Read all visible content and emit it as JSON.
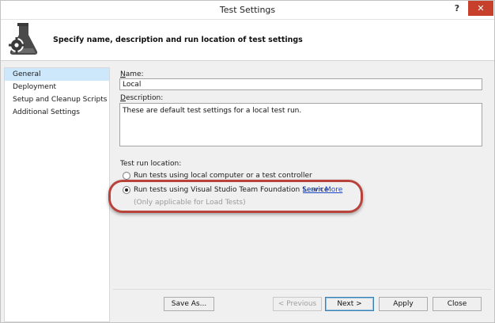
{
  "window": {
    "title": "Test Settings"
  },
  "titlebar": {
    "help_label": "?",
    "close_label": "✕"
  },
  "header": {
    "description": "Specify name, description and run location of test settings",
    "icon": "flask-gear-icon"
  },
  "nav": {
    "items": [
      {
        "label": "General",
        "selected": true
      },
      {
        "label": "Deployment",
        "selected": false
      },
      {
        "label": "Setup and Cleanup Scripts",
        "selected": false
      },
      {
        "label": "Additional Settings",
        "selected": false
      }
    ]
  },
  "form": {
    "name_label": "Name:",
    "name_value": "Local",
    "description_label": "Description:",
    "description_value": "These are default test settings for a local test run.",
    "location_label": "Test run location:",
    "option_local": "Run tests using local computer or a test controller",
    "option_vsts": "Run tests using Visual Studio Team Foundation Service",
    "learn_more": "Learn More",
    "option_vsts_hint": "(Only applicable for Load Tests)",
    "selected_option": "vsts"
  },
  "buttons": {
    "save_as": "Save As...",
    "previous": "< Previous",
    "next": "Next >",
    "apply": "Apply",
    "close": "Close"
  },
  "colors": {
    "highlight_ring": "#b8433b",
    "link": "#1c47c8",
    "nav_selected": "#cde8fb",
    "close_button": "#c7402c"
  }
}
